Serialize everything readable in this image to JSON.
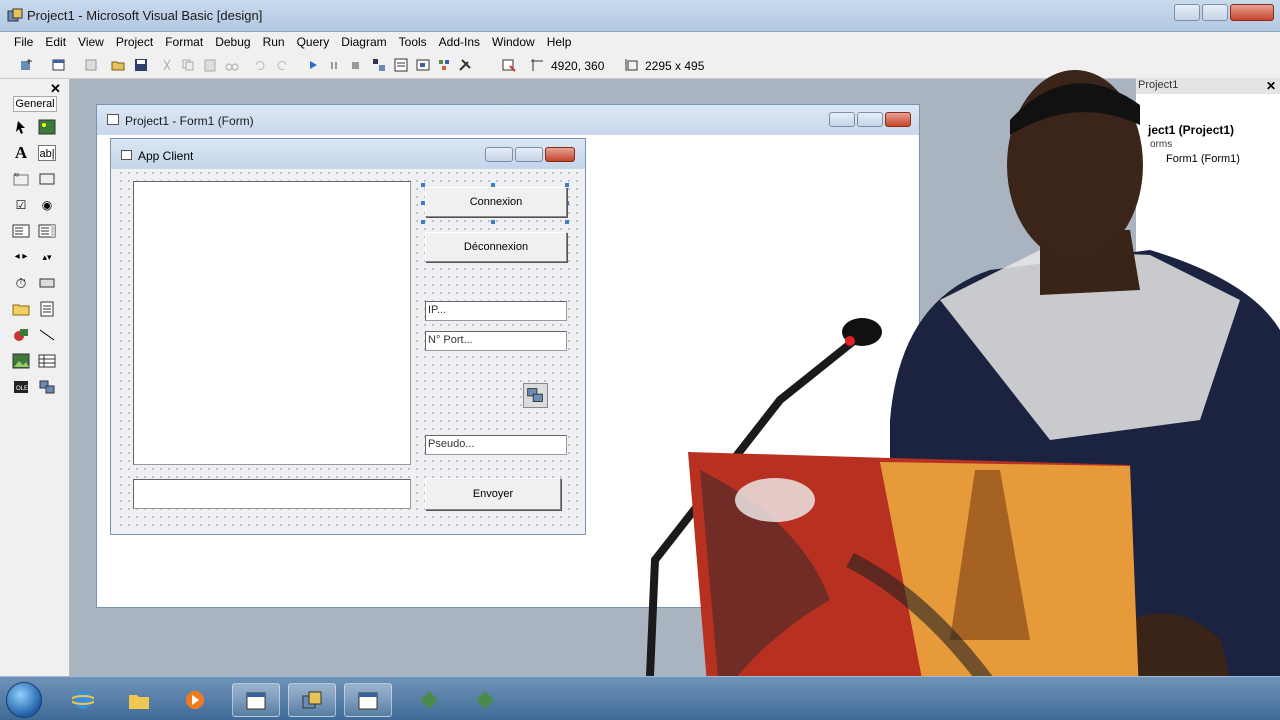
{
  "window": {
    "title": "Project1 - Microsoft Visual Basic [design]"
  },
  "menu": [
    "File",
    "Edit",
    "View",
    "Project",
    "Format",
    "Debug",
    "Run",
    "Query",
    "Diagram",
    "Tools",
    "Add-Ins",
    "Window",
    "Help"
  ],
  "toolbar": {
    "position": "4920, 360",
    "size": "2295 x 495"
  },
  "toolbox": {
    "tab": "General",
    "close": "✕"
  },
  "form_designer": {
    "title": "Project1 - Form1 (Form)"
  },
  "app_form": {
    "title": "App Client",
    "connect_label": "Connexion",
    "disconnect_label": "Déconnexion",
    "ip_value": "IP...",
    "port_value": "N° Port...",
    "pseudo_value": "Pseudo...",
    "send_label": "Envoyer"
  },
  "project_explorer": {
    "title": "Project1",
    "root": "ject1 (Project1)",
    "forms_folder": "orms",
    "form_item": "Form1 (Form1)"
  },
  "colors": {
    "accent": "#3d7cc9",
    "close_button": "#c6452c"
  }
}
